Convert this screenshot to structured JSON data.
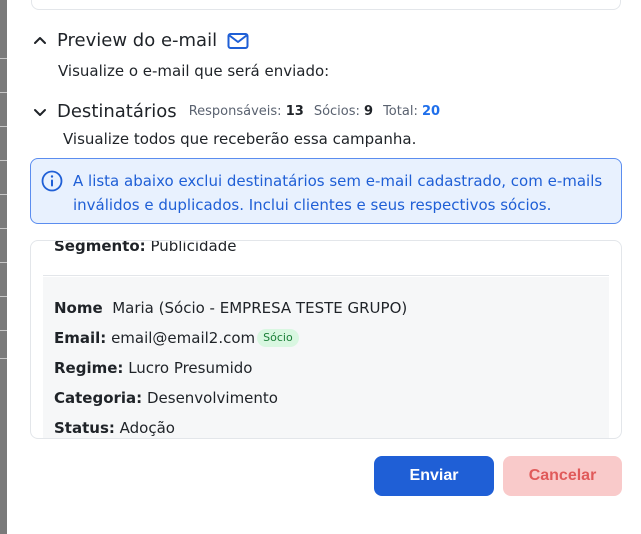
{
  "preview": {
    "title": "Preview do e-mail",
    "subtitle": "Visualize o e-mail que será enviado:"
  },
  "recipients": {
    "title": "Destinatários",
    "responsaveis_label": "Responsáveis:",
    "responsaveis_value": "13",
    "socios_label": "Sócios:",
    "socios_value": "9",
    "total_label": "Total:",
    "total_value": "20",
    "subtitle": "Visualize todos que receberão essa campanha."
  },
  "info": {
    "line1": "A lista abaixo exclui destinatários sem e-mail cadastrado, com e-mails",
    "line2": "inválidos e duplicados. Inclui clientes e seus respectivos sócios."
  },
  "list": {
    "cut_label": "Segmento:",
    "cut_value": "Publicidade",
    "record": {
      "name_label": "Nome",
      "name_value": "Maria (Sócio - EMPRESA TESTE GRUPO)",
      "email_label": "Email:",
      "email_value": "email@email2.com",
      "email_badge": "Sócio",
      "regime_label": "Regime:",
      "regime_value": "Lucro Presumido",
      "categoria_label": "Categoria:",
      "categoria_value": "Desenvolvimento",
      "status_label": "Status:",
      "status_value": "Adoção"
    }
  },
  "actions": {
    "send": "Enviar",
    "cancel": "Cancelar"
  },
  "colors": {
    "primary": "#1f5fd6",
    "info_bg": "#e8f1fe",
    "badge_bg": "#d9f7e1",
    "cancel_bg": "#f9caca"
  }
}
